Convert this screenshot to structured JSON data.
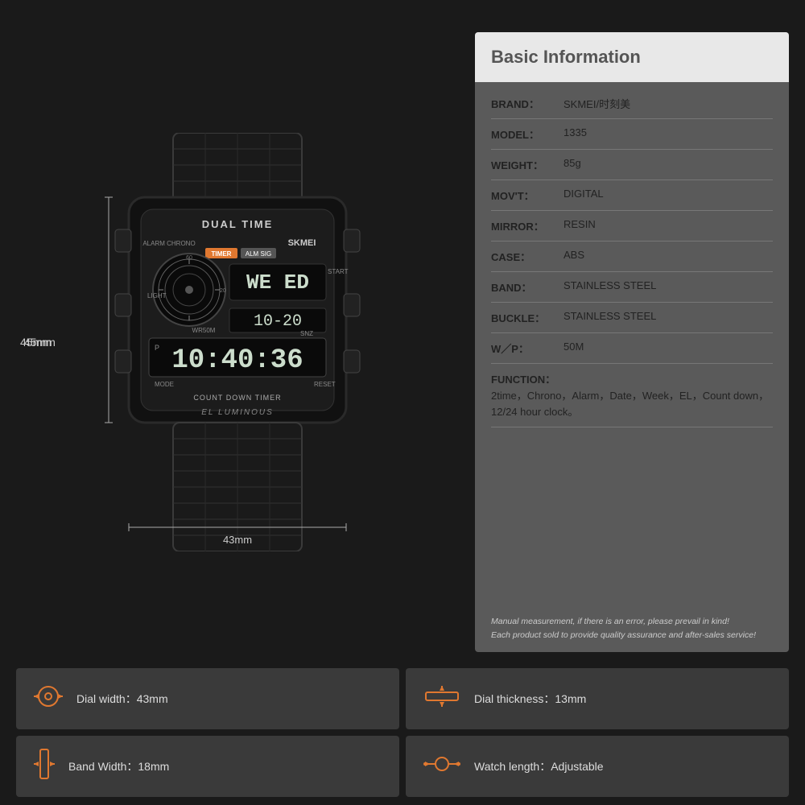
{
  "info_panel": {
    "title": "Basic Information",
    "rows": [
      {
        "label": "BRAND：",
        "value": "SKMEI/时刻美"
      },
      {
        "label": "MODEL：",
        "value": "1335"
      },
      {
        "label": "WEIGHT：",
        "value": "85g"
      },
      {
        "label": "MOV'T：",
        "value": "DIGITAL"
      },
      {
        "label": "MIRROR：",
        "value": "RESIN"
      },
      {
        "label": "CASE：",
        "value": "ABS"
      },
      {
        "label": "BAND：",
        "value": "STAINLESS STEEL"
      },
      {
        "label": "BUCKLE：",
        "value": "STAINLESS STEEL"
      },
      {
        "label": "W／P：",
        "value": "50M"
      }
    ],
    "function_label": "FUNCTION：",
    "function_value": "2time，Chrono，Alarm，Date，Week，EL，Count down，12/24 hour clock。",
    "disclaimer_line1": "Manual measurement, if there is an error, please prevail in kind!",
    "disclaimer_line2": "Each product sold to provide quality assurance and after-sales service!"
  },
  "dimensions": {
    "height": "45mm",
    "width": "43mm"
  },
  "spec_boxes": [
    {
      "label": "Dial width：",
      "value": "43mm",
      "icon": "⊙"
    },
    {
      "label": "Dial thickness：",
      "value": "13mm",
      "icon": "⊟"
    },
    {
      "label": "Band Width：",
      "value": "18mm",
      "icon": "⊞"
    },
    {
      "label": "Watch length：",
      "value": "Adjustable",
      "icon": "⊘"
    }
  ],
  "watch": {
    "brand": "SKMEI",
    "model_text": "DUAL TIME",
    "display_time": "10:40:36",
    "display_secondary": "10-20",
    "features": [
      "ALARM CHRONO",
      "WR50M",
      "COUNT DOWN TIMER",
      "EL LUMINOUS"
    ],
    "buttons": [
      "LIGHT",
      "MODE",
      "START",
      "RESET"
    ]
  }
}
